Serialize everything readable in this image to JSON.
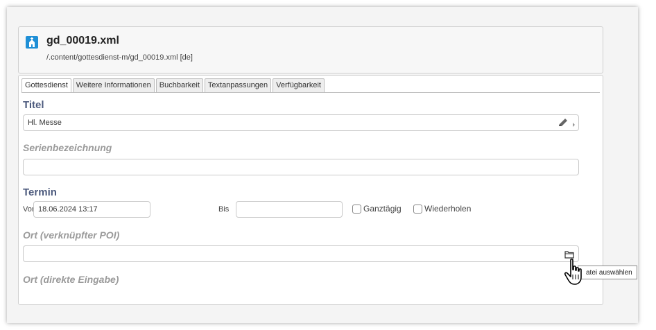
{
  "resource": {
    "title": "gd_00019.xml",
    "path": "/.content/gottesdienst-m/gd_00019.xml [de]"
  },
  "tabs": [
    {
      "label": "Gottesdienst",
      "active": true
    },
    {
      "label": "Weitere Informationen",
      "active": false
    },
    {
      "label": "Buchbarkeit",
      "active": false
    },
    {
      "label": "Textanpassungen",
      "active": false
    },
    {
      "label": "Verfügbarkeit",
      "active": false
    }
  ],
  "form": {
    "titel_label": "Titel",
    "titel_value": "Hl. Messe",
    "serienbezeichnung_label": "Serienbezeichnung",
    "serienbezeichnung_value": "",
    "termin_label": "Termin",
    "von_label": "Von",
    "von_value": "18.06.2024 13:17",
    "bis_label": "Bis",
    "bis_value": "",
    "ganztaegig_label": "Ganztägig",
    "wiederholen_label": "Wiederholen",
    "ort_poi_label": "Ort (verknüpfter POI)",
    "ort_poi_value": "",
    "ort_direkt_label": "Ort (direkte Eingabe)"
  },
  "tooltip": "atei auswählen",
  "icons": {
    "resource": "building-icon",
    "edit": "pencil-icon",
    "expand": "chevron-right-icon",
    "folder": "folder-icon",
    "cursor": "hand-pointer-icon"
  },
  "colors": {
    "label": "#4c5a7d",
    "muted_label": "#9a9a9a",
    "resource_icon": "#1f8fd6"
  }
}
